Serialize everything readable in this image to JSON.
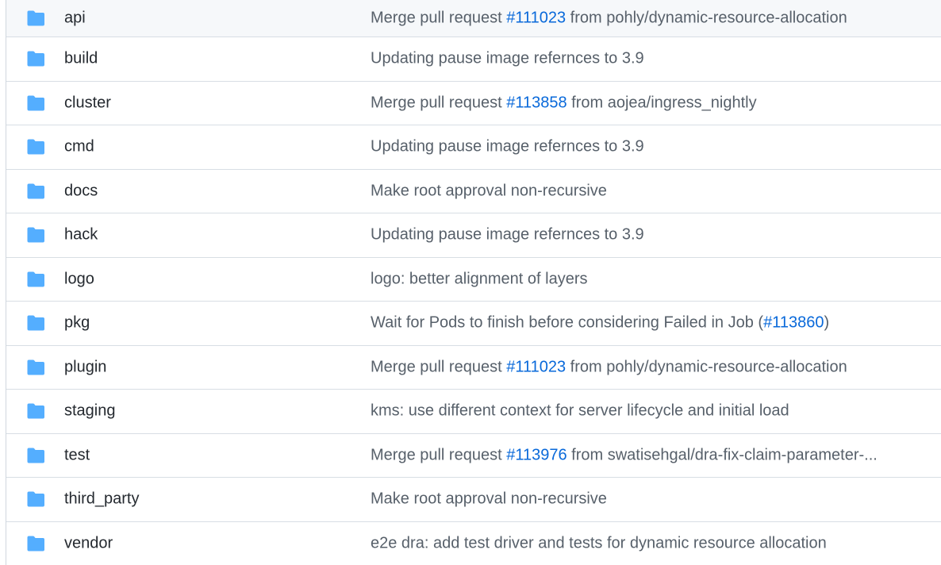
{
  "colors": {
    "folder": "#54aeff",
    "link": "#0969da",
    "name_text": "#24292f",
    "message_text": "#57606a",
    "row_border": "#d8dee4"
  },
  "rows": [
    {
      "icon": "folder-icon",
      "name": "api",
      "message": {
        "before": "Merge pull request ",
        "link": "#111023",
        "after": " from pohly/dynamic-resource-allocation"
      }
    },
    {
      "icon": "folder-icon",
      "name": "build",
      "message": {
        "before": "Updating pause image refernces to 3.9",
        "link": "",
        "after": ""
      }
    },
    {
      "icon": "folder-icon",
      "name": "cluster",
      "message": {
        "before": "Merge pull request ",
        "link": "#113858",
        "after": " from aojea/ingress_nightly"
      }
    },
    {
      "icon": "folder-icon",
      "name": "cmd",
      "message": {
        "before": "Updating pause image refernces to 3.9",
        "link": "",
        "after": ""
      }
    },
    {
      "icon": "folder-icon",
      "name": "docs",
      "message": {
        "before": "Make root approval non-recursive",
        "link": "",
        "after": ""
      }
    },
    {
      "icon": "folder-icon",
      "name": "hack",
      "message": {
        "before": "Updating pause image refernces to 3.9",
        "link": "",
        "after": ""
      }
    },
    {
      "icon": "folder-icon",
      "name": "logo",
      "message": {
        "before": "logo: better alignment of layers",
        "link": "",
        "after": ""
      }
    },
    {
      "icon": "folder-icon",
      "name": "pkg",
      "message": {
        "before": "Wait for Pods to finish before considering Failed in Job (",
        "link": "#113860",
        "after": ")"
      }
    },
    {
      "icon": "folder-icon",
      "name": "plugin",
      "message": {
        "before": "Merge pull request ",
        "link": "#111023",
        "after": " from pohly/dynamic-resource-allocation"
      }
    },
    {
      "icon": "folder-icon",
      "name": "staging",
      "message": {
        "before": "kms: use different context for server lifecycle and initial load",
        "link": "",
        "after": ""
      }
    },
    {
      "icon": "folder-icon",
      "name": "test",
      "message": {
        "before": "Merge pull request ",
        "link": "#113976",
        "after": " from swatisehgal/dra-fix-claim-parameter-..."
      }
    },
    {
      "icon": "folder-icon",
      "name": "third_party",
      "message": {
        "before": "Make root approval non-recursive",
        "link": "",
        "after": ""
      }
    },
    {
      "icon": "folder-icon",
      "name": "vendor",
      "message": {
        "before": "e2e dra: add test driver and tests for dynamic resource allocation",
        "link": "",
        "after": ""
      }
    }
  ]
}
